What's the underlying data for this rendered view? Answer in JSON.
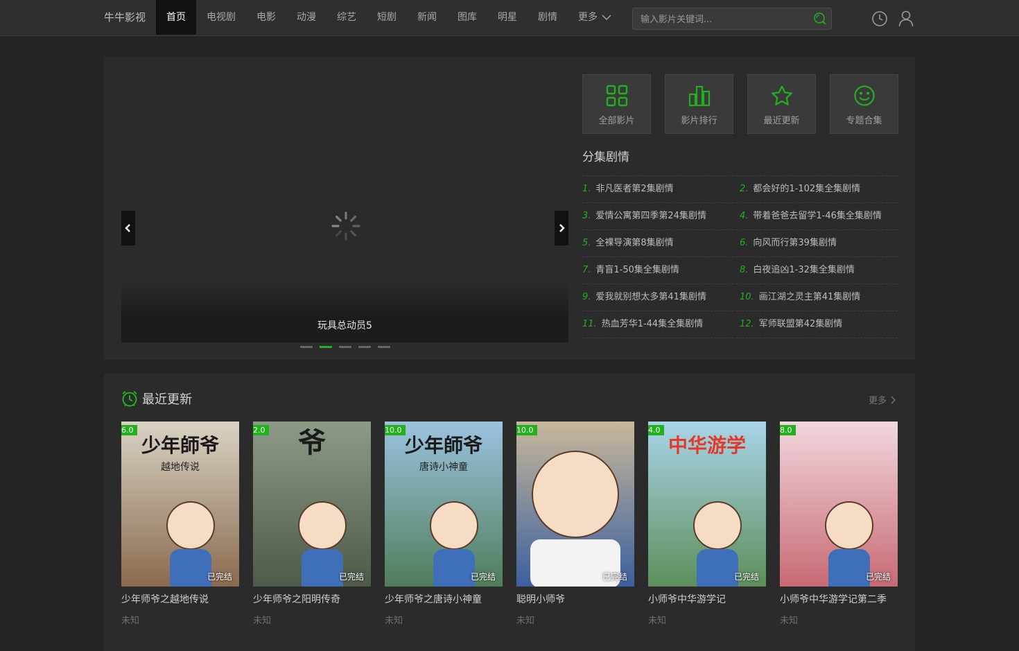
{
  "header": {
    "logo": "牛牛影视",
    "nav": [
      {
        "label": "首页",
        "active": true
      },
      {
        "label": "电视剧"
      },
      {
        "label": "电影"
      },
      {
        "label": "动漫"
      },
      {
        "label": "综艺"
      },
      {
        "label": "短剧"
      },
      {
        "label": "新闻"
      },
      {
        "label": "图库"
      },
      {
        "label": "明星"
      },
      {
        "label": "剧情"
      }
    ],
    "more_label": "更多",
    "search_placeholder": "输入影片关键词...",
    "icons": [
      "history-clock-icon",
      "user-icon",
      "search-icon"
    ]
  },
  "slider": {
    "caption": "玩具总动员5",
    "slide_count": 5,
    "active_index": 1
  },
  "quick_links": [
    {
      "label": "全部影片",
      "icon": "grid-icon"
    },
    {
      "label": "影片排行",
      "icon": "ranking-bars-icon"
    },
    {
      "label": "最近更新",
      "icon": "star-icon"
    },
    {
      "label": "专题合集",
      "icon": "smiley-icon"
    }
  ],
  "episodes": {
    "title": "分集剧情",
    "items": [
      {
        "num": "1.",
        "text": "非凡医者第2集剧情"
      },
      {
        "num": "2.",
        "text": "都会好的1-102集全集剧情"
      },
      {
        "num": "3.",
        "text": "爱情公寓第四季第24集剧情"
      },
      {
        "num": "4.",
        "text": "带着爸爸去留学1-46集全集剧情"
      },
      {
        "num": "5.",
        "text": "全裸导演第8集剧情"
      },
      {
        "num": "6.",
        "text": "向风而行第39集剧情"
      },
      {
        "num": "7.",
        "text": "青盲1-50集全集剧情"
      },
      {
        "num": "8.",
        "text": "白夜追凶1-32集全集剧情"
      },
      {
        "num": "9.",
        "text": "爱我就别想太多第41集剧情"
      },
      {
        "num": "10.",
        "text": "画江湖之灵主第41集剧情"
      },
      {
        "num": "11.",
        "text": "热血芳华1-44集全集剧情"
      },
      {
        "num": "12.",
        "text": "军师联盟第42集剧情"
      }
    ]
  },
  "recent": {
    "title": "最近更新",
    "more_label": "更多",
    "cards": [
      {
        "title": "少年师爷之越地传说",
        "score": "6.0",
        "status": "已完结",
        "actor": "未知",
        "poster_text": "少年師爷",
        "poster_sub": "越地传说",
        "colors": [
          "#d8d3c4",
          "#8a6a4e"
        ]
      },
      {
        "title": "少年师爷之阳明传奇",
        "score": "2.0",
        "status": "已完结",
        "actor": "未知",
        "poster_text": "爷",
        "poster_sub": "",
        "colors": [
          "#8d9a86",
          "#4e5a49"
        ]
      },
      {
        "title": "少年师爷之唐诗小神童",
        "score": "10.0",
        "status": "已完结",
        "actor": "未知",
        "poster_text": "少年師爷",
        "poster_sub": "唐诗小神童",
        "colors": [
          "#9bc3e0",
          "#4f7d5a"
        ]
      },
      {
        "title": "聪明小师爷",
        "score": "10.0",
        "status": "已完结",
        "actor": "未知",
        "poster_text": "",
        "poster_sub": "",
        "colors": [
          "#c8b89a",
          "#3b5fa0"
        ]
      },
      {
        "title": "小师爷中华游学记",
        "score": "4.0",
        "status": "已完结",
        "actor": "未知",
        "poster_text": "中华游学",
        "poster_sub": "",
        "colors": [
          "#a9d4e8",
          "#5c8f5a"
        ]
      },
      {
        "title": "小师爷中华游学记第二季",
        "score": "8.0",
        "status": "已完结",
        "actor": "未知",
        "poster_text": "",
        "poster_sub": "",
        "colors": [
          "#f1d7dd",
          "#c86a74"
        ]
      }
    ]
  },
  "accent_color": "#22b01f"
}
